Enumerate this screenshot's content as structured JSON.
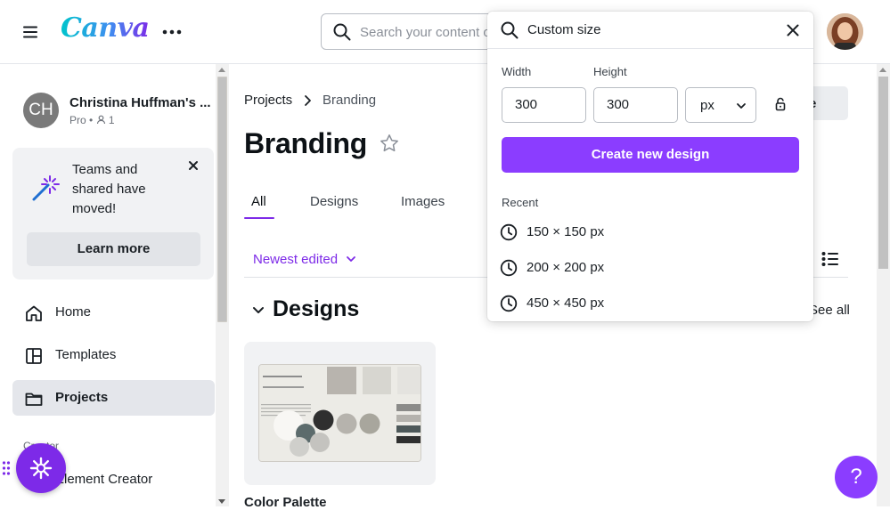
{
  "app": {
    "logo_text": "Canva",
    "brand_color": "#7d2ae8"
  },
  "topbar": {
    "search_placeholder": "Search your content o"
  },
  "account": {
    "initials": "CH",
    "name": "Christina Huffman's ...",
    "plan": "Pro",
    "members": "1"
  },
  "promo": {
    "text": "Teams and shared have moved!",
    "button": "Learn more"
  },
  "nav": {
    "home": "Home",
    "templates": "Templates",
    "projects": "Projects",
    "creator_section": "Creator",
    "element_creator": "Element Creator"
  },
  "breadcrumb": {
    "parent": "Projects",
    "current": "Branding"
  },
  "page": {
    "title": "Branding",
    "share_suffix": "e"
  },
  "tabs": [
    {
      "label": "All"
    },
    {
      "label": "Designs"
    },
    {
      "label": "Images"
    }
  ],
  "sort": {
    "label": "Newest edited"
  },
  "section": {
    "title": "Designs",
    "see_all": "See all"
  },
  "design_card": {
    "title": "Color Palette"
  },
  "dropdown": {
    "search_value": "Custom size",
    "width_label": "Width",
    "width_value": "300",
    "height_label": "Height",
    "height_value": "300",
    "unit": "px",
    "create_button": "Create new design",
    "recent_label": "Recent",
    "recent": [
      "150 × 150 px",
      "200 × 200 px",
      "450 × 450 px"
    ]
  },
  "help": {
    "label": "?"
  },
  "icons": [
    "hamburger-icon",
    "more-icon",
    "search-icon",
    "close-icon",
    "magic-wand-icon",
    "home-icon",
    "templates-icon",
    "folder-icon",
    "chevron-right-icon",
    "star-icon",
    "chevron-down-icon",
    "list-view-icon",
    "lock-icon",
    "clock-icon",
    "sparkle-icon"
  ]
}
